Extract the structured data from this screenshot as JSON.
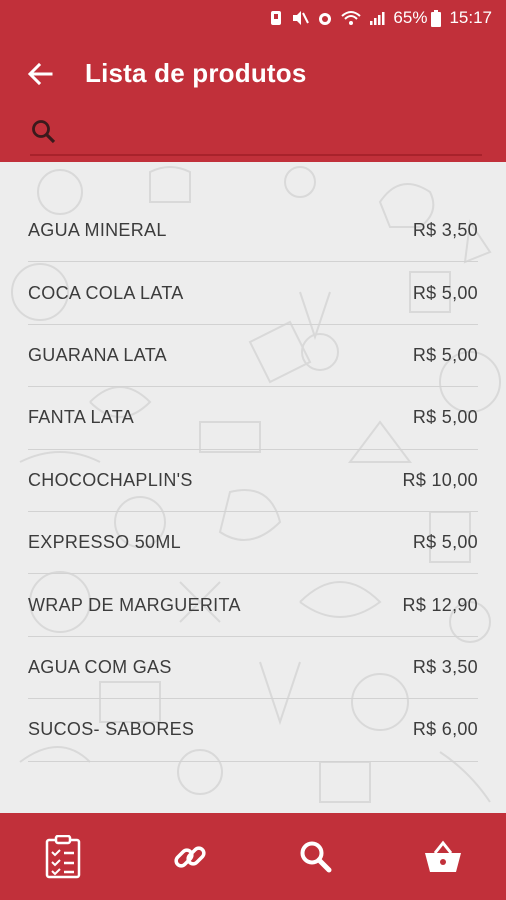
{
  "status": {
    "battery": "65%",
    "time": "15:17"
  },
  "header": {
    "title": "Lista de produtos",
    "search_value": "",
    "search_placeholder": ""
  },
  "products": [
    {
      "name": "AGUA MINERAL",
      "price": "R$ 3,50"
    },
    {
      "name": "COCA COLA LATA",
      "price": "R$ 5,00"
    },
    {
      "name": "GUARANA LATA",
      "price": "R$ 5,00"
    },
    {
      "name": "FANTA LATA",
      "price": "R$ 5,00"
    },
    {
      "name": "CHOCOCHAPLIN'S",
      "price": "R$ 10,00"
    },
    {
      "name": "EXPRESSO 50ML",
      "price": "R$ 5,00"
    },
    {
      "name": "WRAP DE MARGUERITA",
      "price": "R$ 12,90"
    },
    {
      "name": "AGUA COM GAS",
      "price": "R$ 3,50"
    },
    {
      "name": "SUCOS- SABORES",
      "price": "R$ 6,00"
    }
  ],
  "bottom_nav": [
    {
      "icon": "clipboard-list-icon"
    },
    {
      "icon": "link-icon"
    },
    {
      "icon": "search-icon"
    },
    {
      "icon": "basket-icon"
    }
  ],
  "colors": {
    "primary": "#c1303a",
    "background": "#ededed",
    "text": "#3c3c3c"
  }
}
